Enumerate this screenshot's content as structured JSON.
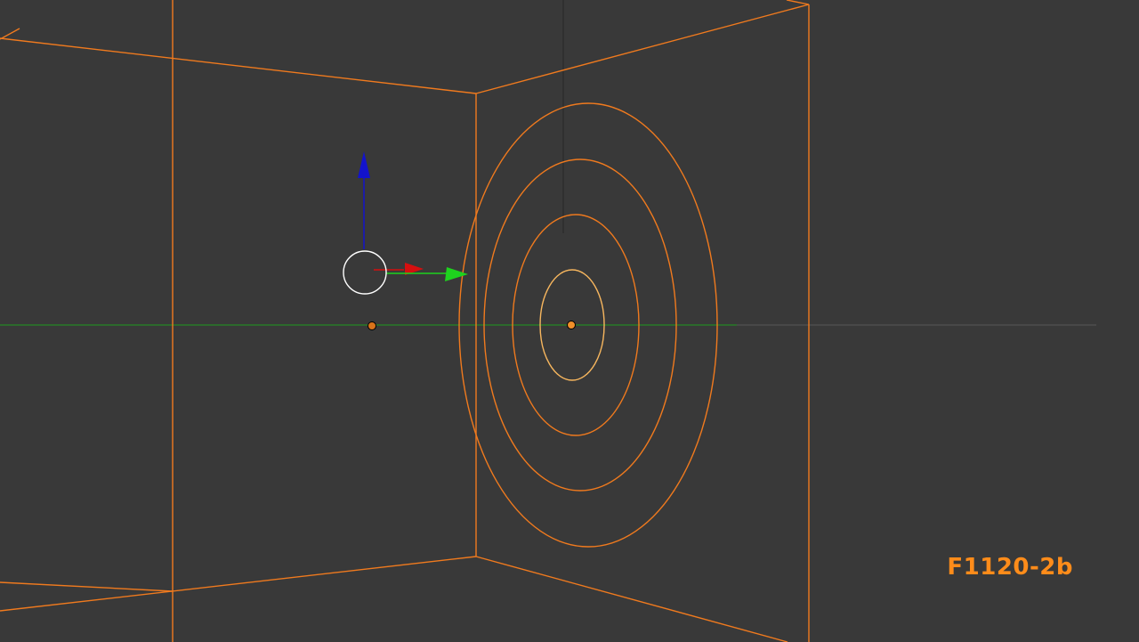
{
  "viewport": {
    "frame_label": "F1120-2b",
    "colors": {
      "background": "#393939",
      "wireframe": "#f07a1e",
      "wireframe_active": "#f7b65e",
      "x_axis": "#d60f0f",
      "y_axis": "#1ed31e",
      "z_axis": "#1313cc",
      "floor_axis_line": "#1e9a1e",
      "grid_line": "#575757",
      "gizmo_ring": "#ffffff"
    },
    "icons": {
      "transform_gizmo": "move-manipulator-icon",
      "origin_dot": "object-origin-icon"
    }
  }
}
